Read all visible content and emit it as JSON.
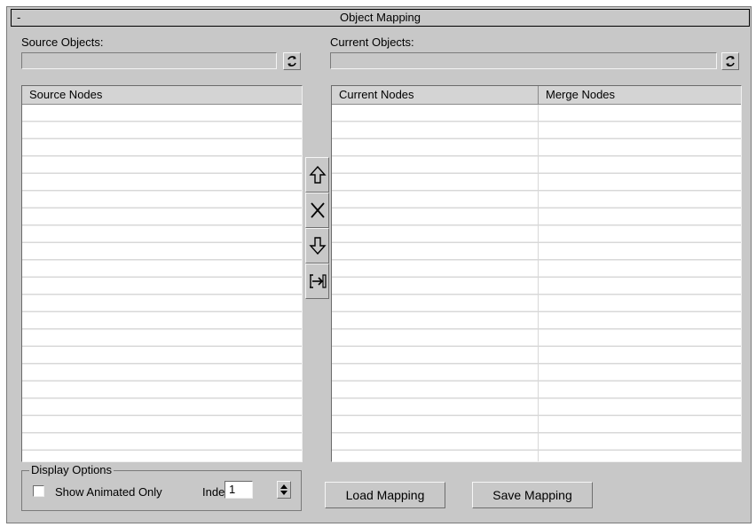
{
  "rollout": {
    "toggle": "-",
    "title": "Object Mapping"
  },
  "source": {
    "label": "Source Objects:",
    "value": "",
    "list": {
      "columns": [
        "Source Nodes"
      ]
    }
  },
  "current": {
    "label": "Current Objects:",
    "value": "",
    "list": {
      "columns": [
        "Current Nodes",
        "Merge Nodes"
      ]
    }
  },
  "tools": [
    {
      "name": "move-up",
      "icon": "arrow-up-icon"
    },
    {
      "name": "remove",
      "icon": "x-icon"
    },
    {
      "name": "move-down",
      "icon": "arrow-down-icon"
    },
    {
      "name": "map",
      "icon": "map-arrow-icon"
    }
  ],
  "display_options": {
    "title": "Display Options",
    "show_animated_label": "Show Animated Only",
    "show_animated_checked": false,
    "indent_label": "Indent:",
    "indent_value": "1"
  },
  "buttons": {
    "load": "Load Mapping",
    "save": "Save Mapping"
  },
  "colors": {
    "panel": "#c8c8c8",
    "list_bg": "#ffffff",
    "header_bg": "#d4d4d4"
  }
}
